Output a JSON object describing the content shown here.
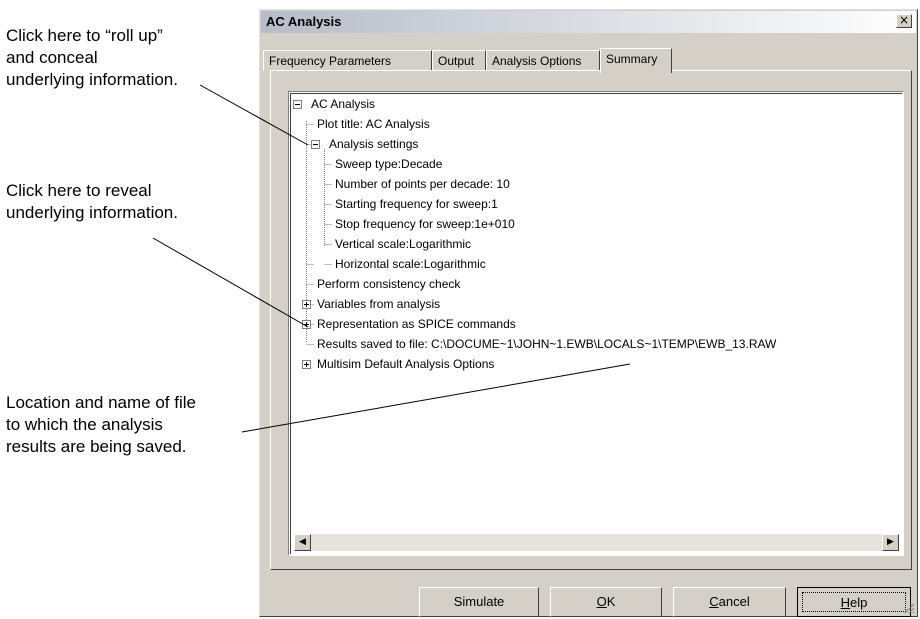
{
  "annotations": {
    "rollup": "Click here to “roll up”\nand conceal\nunderlying information.",
    "reveal": "Click here to reveal\nunderlying information.",
    "location": "Location and name of file\nto which the analysis\nresults are being saved."
  },
  "dialog": {
    "title": "AC Analysis",
    "close_glyph": "×",
    "tabs": [
      "Frequency Parameters",
      "Output",
      "Analysis Options",
      "Summary"
    ],
    "active_tab": "Summary"
  },
  "tree": {
    "root": "AC Analysis",
    "plot_title": "Plot title: AC Analysis",
    "analysis_settings": "Analysis settings",
    "settings": [
      "Sweep type:Decade",
      "Number of points per decade: 10",
      "Starting frequency for sweep:1",
      "Stop frequency for sweep:1e+010",
      "Vertical scale:Logarithmic",
      "Horizontal scale:Logarithmic"
    ],
    "consistency": "Perform consistency check",
    "variables": "Variables from analysis",
    "spice": "Representation as SPICE commands",
    "results": "Results saved to file: C:\\DOCUME~1\\JOHN~1.EWB\\LOCALS~1\\TEMP\\EWB_13.RAW",
    "multisim": "Multisim Default Analysis Options"
  },
  "buttons": {
    "simulate": "Simulate",
    "ok_mnemonic": "O",
    "ok_rest": "K",
    "cancel_mnemonic": "C",
    "cancel_rest": "ancel",
    "help_mnemonic": "H",
    "help_rest": "elp"
  },
  "icons": {
    "collapse": "minus-box-icon",
    "expand": "plus-box-icon",
    "scroll_left": "left-arrow-icon",
    "scroll_right": "right-arrow-icon",
    "close": "close-x-icon"
  }
}
